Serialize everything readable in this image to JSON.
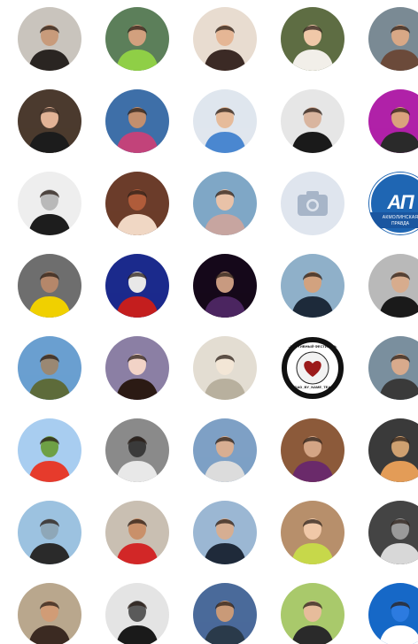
{
  "grid": {
    "columns": [
      56,
      155,
      254,
      353,
      452
    ],
    "rows": [
      44,
      137,
      230,
      323,
      416,
      509,
      602,
      695
    ],
    "size": 72
  },
  "avatars": [
    {
      "name": "avatar-r1c1",
      "bg": "#c9c4bd",
      "fg": "#2a2522",
      "skin": "#c89b7b"
    },
    {
      "name": "avatar-r1c2",
      "bg": "#5c7f5a",
      "fg": "#8fcf46",
      "skin": "#d2a07e"
    },
    {
      "name": "avatar-r1c3",
      "bg": "#e8dcd0",
      "fg": "#3b2a25",
      "skin": "#e5b695"
    },
    {
      "name": "avatar-r1c4",
      "bg": "#5e6d43",
      "fg": "#f2efe9",
      "skin": "#f0c8a8"
    },
    {
      "name": "avatar-r1c5",
      "bg": "#7a8a94",
      "fg": "#6b4a3a",
      "skin": "#d8a886"
    },
    {
      "name": "avatar-r2c1",
      "bg": "#4b3a2e",
      "fg": "#1c1c1c",
      "skin": "#e2b396"
    },
    {
      "name": "avatar-r2c2",
      "bg": "#3e6fa8",
      "fg": "#c2437a",
      "skin": "#c38f6e"
    },
    {
      "name": "avatar-r2c3",
      "bg": "#dfe6ee",
      "fg": "#4a87d0",
      "skin": "#e6bb9a"
    },
    {
      "name": "avatar-r2c4",
      "bg": "#e6e6e6",
      "fg": "#1a1a1a",
      "skin": "#d9b59f"
    },
    {
      "name": "avatar-r2c5",
      "bg": "#b021a8",
      "fg": "#2a2a2a",
      "skin": "#d9a27d"
    },
    {
      "name": "avatar-r3c1",
      "bg": "#eeeeee",
      "fg": "#1d1d1d",
      "skin": "#b9b9b9"
    },
    {
      "name": "avatar-r3c2",
      "bg": "#6b3c2a",
      "fg": "#f0d7c4",
      "skin": "#b05c3a"
    },
    {
      "name": "avatar-r3c3",
      "bg": "#7fa7c6",
      "fg": "#c7a5a0",
      "skin": "#e9c2a8"
    },
    {
      "name": "avatar-r3c4",
      "placeholder": true,
      "bg": "#dfe5ee",
      "fg": "#a7b5c8"
    },
    {
      "name": "avatar-r3c5",
      "logo": true,
      "bg": "#1f66b3",
      "fg": "#ffffff",
      "label_main": "АП",
      "label_sub1": "АКМОЛИНСКАЯ",
      "label_sub2": "ПРАВДА"
    },
    {
      "name": "avatar-r4c1",
      "bg": "#6e6e6e",
      "fg": "#f0d000",
      "skin": "#b5876a"
    },
    {
      "name": "avatar-r4c2",
      "bg": "#1b2a8c",
      "fg": "#c41e1e",
      "skin": "#e8e8e8"
    },
    {
      "name": "avatar-r4c3",
      "bg": "#15081a",
      "fg": "#4b2560",
      "skin": "#c89a80"
    },
    {
      "name": "avatar-r4c4",
      "bg": "#8fb0c9",
      "fg": "#1d2a3a",
      "skin": "#d2a27f"
    },
    {
      "name": "avatar-r4c5",
      "bg": "#b9b9b9",
      "fg": "#1a1a1a",
      "skin": "#d7ac8d"
    },
    {
      "name": "avatar-r5c1",
      "bg": "#6a9fd0",
      "fg": "#5d6b3a",
      "skin": "#9a8873"
    },
    {
      "name": "avatar-r5c2",
      "bg": "#8b7fa4",
      "fg": "#2b1a14",
      "skin": "#f2d3c7"
    },
    {
      "name": "avatar-r5c3",
      "bg": "#e3ddd2",
      "fg": "#b8b09e",
      "skin": "#f3e6d6"
    },
    {
      "name": "avatar-r5c4",
      "emblem": true,
      "bg": "#ffffff",
      "fg": "#9b1a1a",
      "label_top": "СПОРТИВНЫЙ ФЕСТИВАЛЬ",
      "label_bot": "ROAD_BY_NAME_TEAM"
    },
    {
      "name": "avatar-r5c5",
      "bg": "#7a8f9e",
      "fg": "#3a3a3a",
      "skin": "#d8aa8c"
    },
    {
      "name": "avatar-r6c1",
      "bg": "#a8cdf0",
      "fg": "#e63b2c",
      "skin": "#6ea045"
    },
    {
      "name": "avatar-r6c2",
      "bg": "#8a8a8a",
      "fg": "#e8e8e8",
      "skin": "#3a3a3a"
    },
    {
      "name": "avatar-r6c3",
      "bg": "#7ea0c5",
      "fg": "#dcdcdc",
      "skin": "#d8ae92"
    },
    {
      "name": "avatar-r6c4",
      "bg": "#8c5a3a",
      "fg": "#6a2a6a",
      "skin": "#d4a585"
    },
    {
      "name": "avatar-r6c5",
      "bg": "#3a3a3a",
      "fg": "#e39c57",
      "skin": "#cfa070"
    },
    {
      "name": "avatar-r7c1",
      "bg": "#9cc2e0",
      "fg": "#2a2a2a",
      "skin": "#8ea7b8"
    },
    {
      "name": "avatar-r7c2",
      "bg": "#c9bfb2",
      "fg": "#d22727",
      "skin": "#c9906a"
    },
    {
      "name": "avatar-r7c3",
      "bg": "#9bb7d3",
      "fg": "#1f2a3a",
      "skin": "#d6ae92"
    },
    {
      "name": "avatar-r7c4",
      "bg": "#b78f6b",
      "fg": "#c7d84a",
      "skin": "#f0c8a8"
    },
    {
      "name": "avatar-r7c5",
      "bg": "#444444",
      "fg": "#d8d8d8",
      "skin": "#9a9a9a"
    },
    {
      "name": "avatar-r8c1",
      "bg": "#b9a78d",
      "fg": "#3b2a22",
      "skin": "#d19c76"
    },
    {
      "name": "avatar-r8c2",
      "bg": "#e4e4e4",
      "fg": "#1a1a1a",
      "skin": "#5a5a5a"
    },
    {
      "name": "avatar-r8c3",
      "bg": "#4a6a9a",
      "fg": "#2a3a4a",
      "skin": "#c99a78"
    },
    {
      "name": "avatar-r8c4",
      "bg": "#a9c96b",
      "fg": "#2a2a2a",
      "skin": "#e7bc9b"
    },
    {
      "name": "avatar-r8c5",
      "bg": "#1668c7",
      "fg": "#ffffff",
      "skin": "#2c7be0"
    }
  ]
}
